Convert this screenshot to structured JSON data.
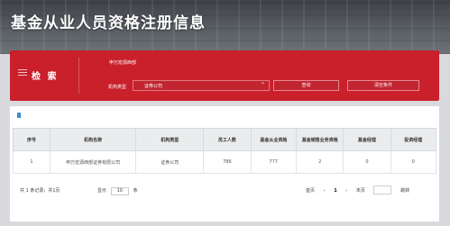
{
  "page": {
    "title": "基金从业人员资格注册信息"
  },
  "filter": {
    "heading": "检 索",
    "name_value": "申万宏源西部",
    "type_label": "机构类型",
    "type_value": "证券公司",
    "query_button": "查询",
    "clear_button": "清空条件"
  },
  "table": {
    "headers": [
      "序号",
      "机构名称",
      "机构类型",
      "员工人数",
      "基金从业资格",
      "基金销售业务资格",
      "基金经理",
      "投资经理"
    ],
    "rows": [
      [
        "1",
        "申万宏源西部证券有限公司",
        "证券公司",
        "786",
        "777",
        "2",
        "0",
        "0"
      ]
    ]
  },
  "footer": {
    "total_text": "共 1 条记录，共1页",
    "page_size_label": "显示",
    "page_size_value": "10",
    "page_size_unit": "条",
    "first": "首页",
    "prev": "‹",
    "current_page": "1",
    "next": "›",
    "last": "末页",
    "jump": "跳转"
  },
  "colors": {
    "accent_red": "#c9202b",
    "marker_blue": "#3b8fd6"
  }
}
